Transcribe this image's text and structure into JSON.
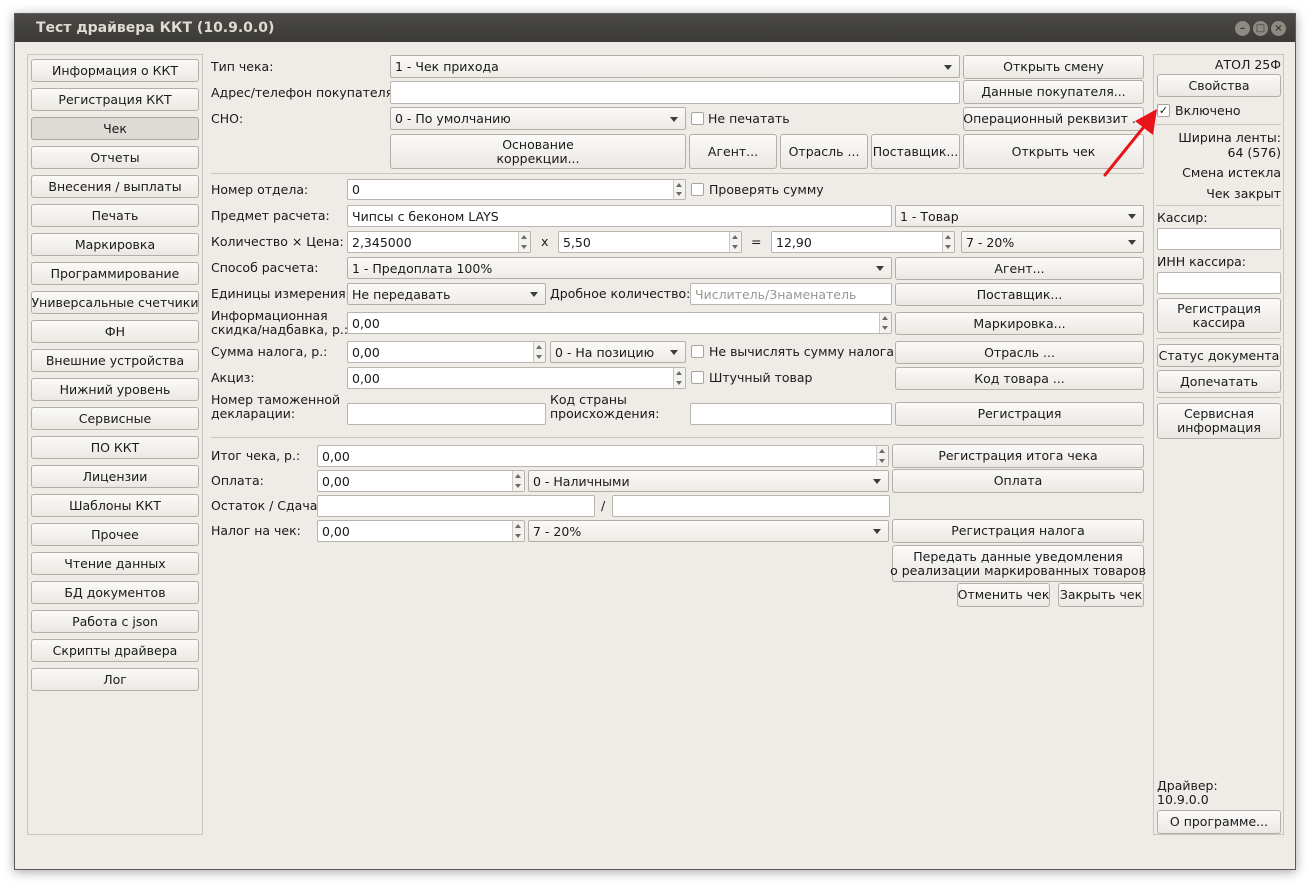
{
  "window": {
    "title": "Тест драйвера ККТ (10.9.0.0)"
  },
  "sidebar": {
    "items": [
      {
        "label": "Информация о ККТ"
      },
      {
        "label": "Регистрация ККТ"
      },
      {
        "label": "Чек"
      },
      {
        "label": "Отчеты"
      },
      {
        "label": "Внесения / выплаты"
      },
      {
        "label": "Печать"
      },
      {
        "label": "Маркировка"
      },
      {
        "label": "Программирование"
      },
      {
        "label": "Универсальные счетчики"
      },
      {
        "label": "ФН"
      },
      {
        "label": "Внешние устройства"
      },
      {
        "label": "Нижний уровень"
      },
      {
        "label": "Сервисные"
      },
      {
        "label": "ПО ККТ"
      },
      {
        "label": "Лицензии"
      },
      {
        "label": "Шаблоны ККТ"
      },
      {
        "label": "Прочее"
      },
      {
        "label": "Чтение данных"
      },
      {
        "label": "БД документов"
      },
      {
        "label": "Работа с json"
      },
      {
        "label": "Скрипты драйвера"
      },
      {
        "label": "Лог"
      }
    ],
    "active": "Чек"
  },
  "receipt": {
    "type_label": "Тип чека:",
    "type_value": "1 - Чек прихода",
    "buyer_label": "Адрес/телефон покупателя:",
    "buyer_value": "",
    "sno_label": "СНО:",
    "sno_value": "0 - По умолчанию",
    "no_print_label": "Не печатать",
    "open_shift": "Открыть смену",
    "buyer_data": "Данные покупателя...",
    "op_requisite": "Операционный реквизит ...",
    "correction_1": "Основание",
    "correction_2": "коррекции...",
    "agent": "Агент...",
    "industry": "Отрасль ...",
    "supplier": "Поставщик...",
    "open_receipt": "Открыть чек"
  },
  "position": {
    "dept_label": "Номер отдела:",
    "dept_value": "0",
    "check_sum_label": "Проверять сумму",
    "item_label": "Предмет расчета:",
    "item_value": "Чипсы с беконом LAYS",
    "item_type": "1 - Товар",
    "qty_price_label": "Количество × Цена:",
    "qty_value": "2,345000",
    "times": "x",
    "price_value": "5,50",
    "equals": "=",
    "sum_value": "12,90",
    "vat_value": "7 - 20%",
    "method_label": "Способ расчета:",
    "method_value": "1 - Предоплата 100%",
    "agent_btn": "Агент...",
    "units_label": "Единицы измерения:",
    "units_value": "Не передавать",
    "fraction_label": "Дробное количество:",
    "fraction_placeholder": "Числитель/Знаменатель",
    "supplier_btn": "Поставщик...",
    "discount_label_1": "Информационная",
    "discount_label_2": "скидка/надбавка, р.:",
    "discount_value": "0,00",
    "marking_btn": "Маркировка...",
    "tax_label": "Сумма налога, р.:",
    "tax_value": "0,00",
    "tax_mode": "0 - На позицию",
    "no_calc_tax_label": "Не вычислять сумму налога",
    "industry_btn": "Отрасль ...",
    "excise_label": "Акциз:",
    "excise_value": "0,00",
    "piece_label": "Штучный товар",
    "product_code_btn": "Код товара ...",
    "customs_label_1": "Номер таможенной",
    "customs_label_2": "декларации:",
    "country_label_1": "Код страны",
    "country_label_2": "происхождения:",
    "register_btn": "Регистрация"
  },
  "totals": {
    "total_label": "Итог чека, р.:",
    "total_value": "0,00",
    "reg_total_btn": "Регистрация итога чека",
    "payment_label": "Оплата:",
    "payment_value": "0,00",
    "payment_type": "0 - Наличными",
    "payment_btn": "Оплата",
    "change_label": "Остаток / Сдача:",
    "slash": "/",
    "receipt_tax_label": "Налог на чек:",
    "receipt_tax_value": "0,00",
    "receipt_tax_rate": "7 - 20%",
    "reg_tax_btn": "Регистрация налога",
    "notify_1": "Передать данные уведомления",
    "notify_2": "о реализации маркированных товаров",
    "cancel_btn": "Отменить чек",
    "close_btn": "Закрыть чек"
  },
  "right": {
    "model": "АТОЛ 25Ф",
    "properties": "Свойства",
    "enabled_label": "Включено",
    "tape_width_label": "Ширина ленты:",
    "tape_width_value": "64 (576)",
    "shift_status": "Смена истекла",
    "receipt_status": "Чек закрыт",
    "cashier_label": "Кассир:",
    "cashier_inn_label": "ИНН кассира:",
    "reg_cashier_1": "Регистрация",
    "reg_cashier_2": "кассира",
    "doc_status": "Статус документа",
    "reprint": "Допечатать",
    "service_info_1": "Сервисная",
    "service_info_2": "информация",
    "driver_label": "Драйвер:",
    "driver_version": "10.9.0.0",
    "about": "О программе..."
  }
}
